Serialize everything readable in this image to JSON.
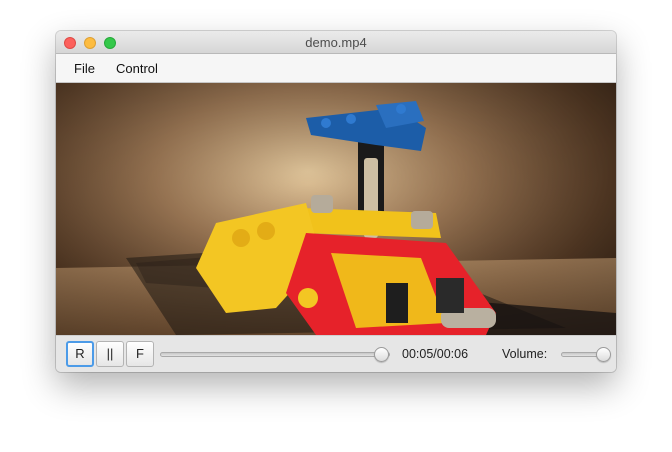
{
  "window": {
    "title": "demo.mp4"
  },
  "menu": {
    "items": [
      "File",
      "Control"
    ]
  },
  "controls": {
    "buttons": [
      "R",
      "||",
      "F"
    ],
    "time_display": "00:05/00:06",
    "progress_fraction": 0.96,
    "volume_label": "Volume:",
    "volume_fraction": 1.0
  }
}
